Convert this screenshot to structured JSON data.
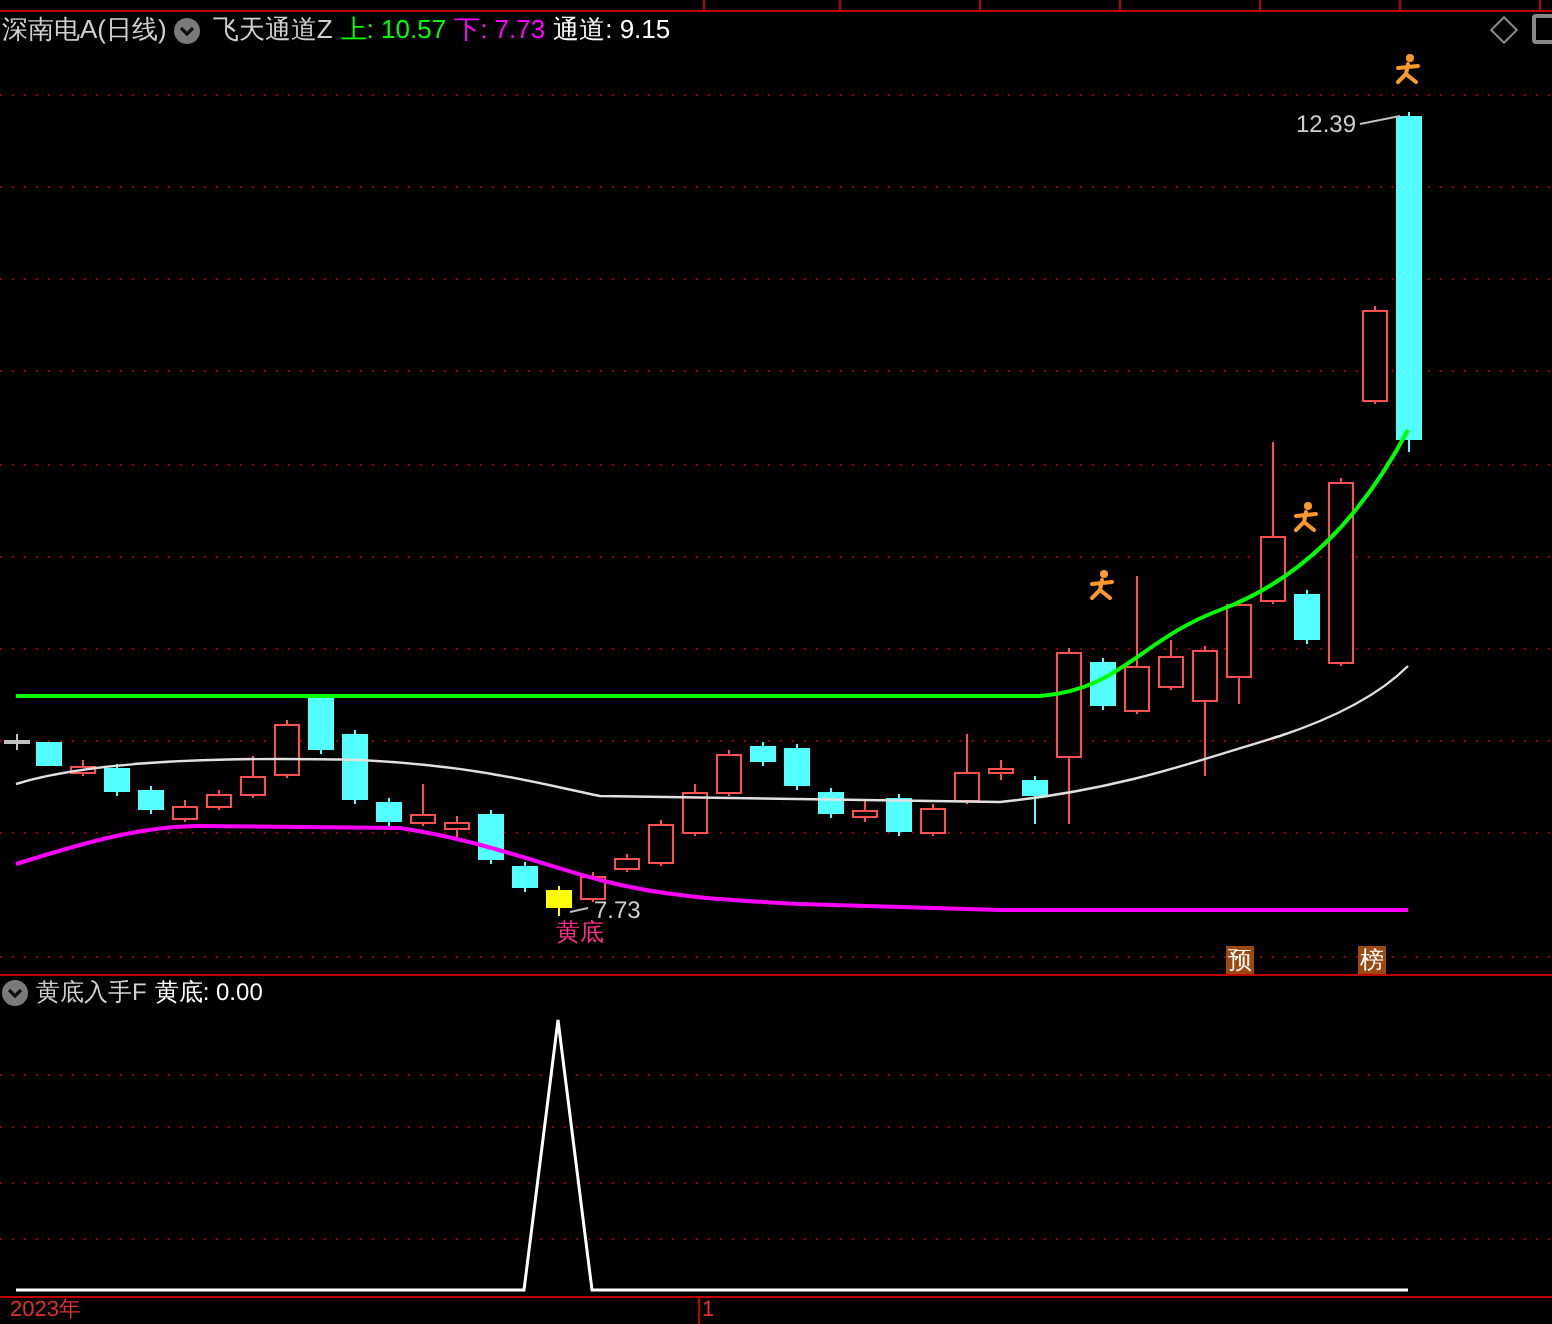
{
  "main_panel": {
    "title": "深南电A(日线)",
    "indicator": "飞天通道Z",
    "readings": [
      {
        "label": "上:",
        "value": "10.57",
        "color": "#00ff00"
      },
      {
        "label": "下:",
        "value": "7.73",
        "color": "#ff00ff"
      },
      {
        "label": "通道:",
        "value": "9.15",
        "color": "#ffffff"
      }
    ],
    "high_label": "12.39",
    "low_label": "7.73",
    "signal_label": "黄底",
    "tags": [
      "预",
      "榜"
    ]
  },
  "sub_panel": {
    "indicator": "黄底入手F",
    "label": "黄底:",
    "value": "0.00"
  },
  "time_axis": {
    "year": "2023年",
    "month": "1"
  }
}
